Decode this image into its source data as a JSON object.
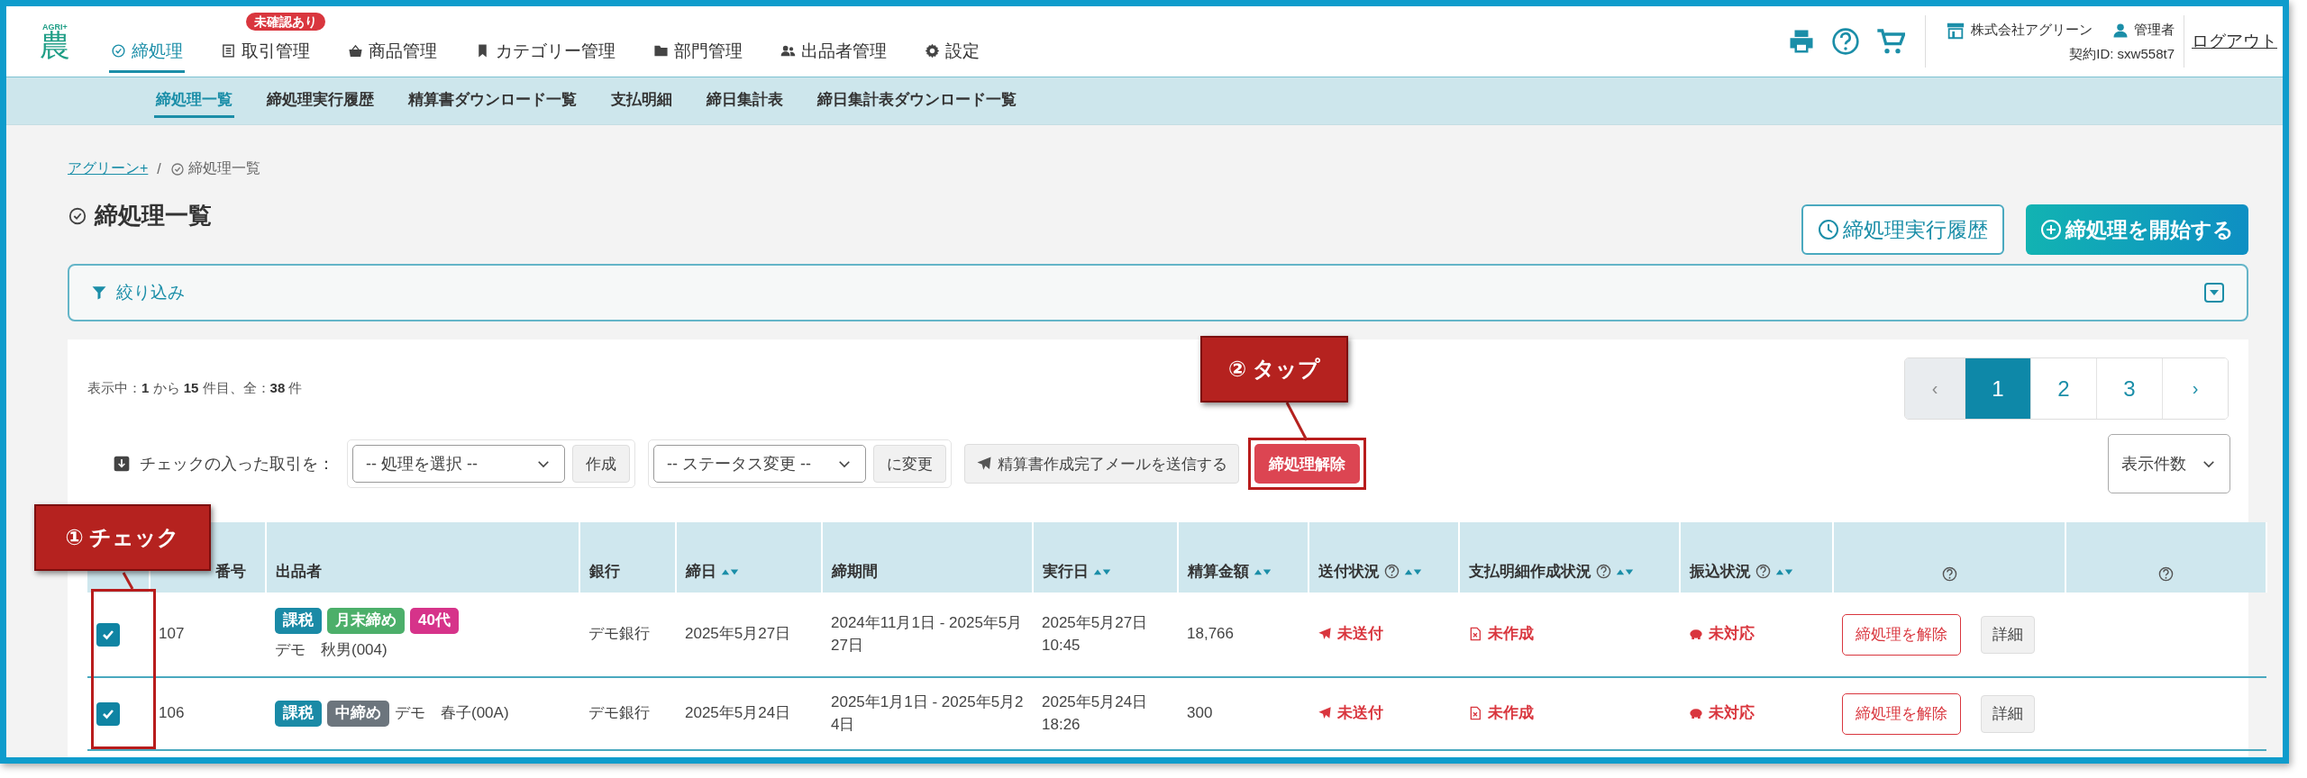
{
  "header": {
    "logo": {
      "badge": "AGRI+",
      "mark": "農"
    },
    "nav": [
      {
        "label": "締処理",
        "selected": true
      },
      {
        "label": "取引管理",
        "selected": false,
        "badge": "未確認あり"
      },
      {
        "label": "商品管理",
        "selected": false
      },
      {
        "label": "カテゴリー管理",
        "selected": false
      },
      {
        "label": "部門管理",
        "selected": false
      },
      {
        "label": "出品者管理",
        "selected": false
      },
      {
        "label": "設定",
        "selected": false
      }
    ],
    "account": {
      "company": "株式会社アグリーン",
      "role": "管理者",
      "contract": "契約ID: sxw558t7",
      "logout": "ログアウト"
    }
  },
  "subnav": [
    {
      "label": "締処理一覧",
      "selected": true
    },
    {
      "label": "締処理実行履歴",
      "selected": false
    },
    {
      "label": "精算書ダウンロード一覧",
      "selected": false
    },
    {
      "label": "支払明細",
      "selected": false
    },
    {
      "label": "締日集計表",
      "selected": false
    },
    {
      "label": "締日集計表ダウンロード一覧",
      "selected": false
    }
  ],
  "breadcrumb": {
    "items": [
      {
        "label": "アグリーン+",
        "kind": "link"
      },
      {
        "label": "締処理一覧",
        "kind": "current"
      }
    ],
    "separator": "/"
  },
  "page_title": "締処理一覧",
  "actions": [
    {
      "label": "締処理実行履歴",
      "kind": "outline"
    },
    {
      "label": "締処理を開始する",
      "kind": "primary"
    }
  ],
  "filter": {
    "label": "絞り込み",
    "expanded": false
  },
  "summary": "表示中：**1** から **15** 件目、全：**38** 件",
  "pagination": {
    "prev": "‹",
    "pages": [
      {
        "label": "1",
        "selected": true
      },
      {
        "label": "2",
        "selected": false
      },
      {
        "label": "3",
        "selected": false
      }
    ],
    "next": "›"
  },
  "bulk": {
    "label": "チェックの入った取引を：",
    "action_select": "-- 処理を選択 --",
    "action_button": "作成",
    "status_select": "-- ステータス変更 --",
    "status_button": "に変更",
    "mail_button": "精算書作成完了メールを送信する",
    "release_button": "締処理解除"
  },
  "page_size": "表示件数",
  "table": {
    "columns": [
      {
        "label": "番号",
        "sortable": false,
        "help": false
      },
      {
        "label": "出品者",
        "sortable": false,
        "help": false
      },
      {
        "label": "銀行",
        "sortable": false,
        "help": false
      },
      {
        "label": "締日",
        "sortable": true,
        "help": false
      },
      {
        "label": "締期間",
        "sortable": false,
        "help": false
      },
      {
        "label": "実行日",
        "sortable": true,
        "help": false
      },
      {
        "label": "精算金額",
        "sortable": true,
        "help": false
      },
      {
        "label": "送付状況",
        "sortable": true,
        "help": true
      },
      {
        "label": "支払明細作成状況",
        "sortable": true,
        "help": true
      },
      {
        "label": "振込状況",
        "sortable": true,
        "help": true
      },
      {
        "sortable": false,
        "help": true
      },
      {
        "sortable": false,
        "help": true
      }
    ],
    "rows": [
      {
        "checked": true,
        "number": "107",
        "tags": [
          {
            "label": "課税",
            "color": "#1a8aa6"
          },
          {
            "label": "月末締め",
            "color": "#4caf6a"
          },
          {
            "label": "40代",
            "color": "#d6338a"
          }
        ],
        "seller": "デモ　秋男(004)",
        "bank": "デモ銀行",
        "closing_date": "2025年5月27日",
        "period": "2024年11月1日 - 2025年5月27日",
        "executed": "2025年5月27日 10:45",
        "amount": "18,766",
        "delivery": "未送付",
        "statement": "未作成",
        "transfer": "未対応",
        "release": "締処理を解除",
        "detail": "詳細"
      },
      {
        "checked": true,
        "number": "106",
        "tags": [
          {
            "label": "課税",
            "color": "#1a8aa6"
          },
          {
            "label": "中締め",
            "color": "#6c757d"
          }
        ],
        "seller": "デモ　春子(00A)",
        "bank": "デモ銀行",
        "closing_date": "2025年5月24日",
        "period": "2025年1月1日 - 2025年5月24日",
        "executed": "2025年5月24日 18:26",
        "amount": "300",
        "delivery": "未送付",
        "statement": "未作成",
        "transfer": "未対応",
        "release": "締処理を解除",
        "detail": "詳細"
      }
    ]
  },
  "callouts": [
    {
      "kind": "check",
      "label": "① チェック"
    },
    {
      "kind": "tap",
      "label": "② タップ"
    }
  ]
}
